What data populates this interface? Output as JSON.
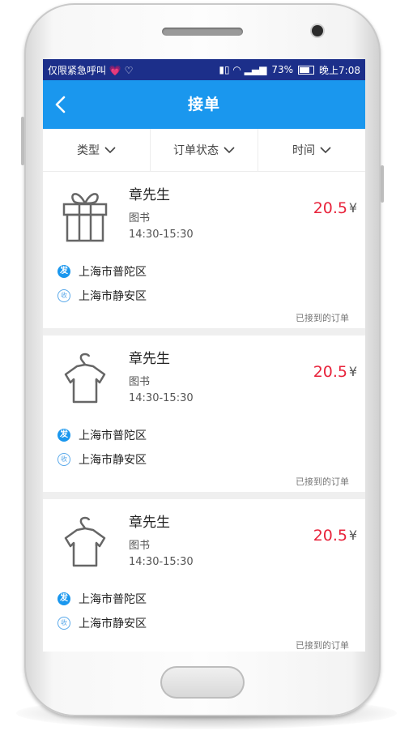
{
  "statusbar": {
    "left": "仅限紧急呼叫 💗 ♡",
    "battery": "73%",
    "time": "晚上7:08"
  },
  "navbar": {
    "title": "接单",
    "back_icon": "chevron-left-icon"
  },
  "filters": [
    {
      "label": "类型"
    },
    {
      "label": "订单状态"
    },
    {
      "label": "时间"
    }
  ],
  "orders": [
    {
      "icon": "gift-icon",
      "name": "章先生",
      "category": "图书",
      "time": "14:30-15:30",
      "price": "20.5",
      "currency": "¥",
      "from_badge": "发",
      "from": "上海市普陀区",
      "to_badge": "收",
      "to": "上海市静安区",
      "status": "已接到的订单"
    },
    {
      "icon": "tshirt-icon",
      "name": "章先生",
      "category": "图书",
      "time": "14:30-15:30",
      "price": "20.5",
      "currency": "¥",
      "from_badge": "发",
      "from": "上海市普陀区",
      "to_badge": "收",
      "to": "上海市静安区",
      "status": "已接到的订单"
    },
    {
      "icon": "tshirt-icon",
      "name": "章先生",
      "category": "图书",
      "time": "14:30-15:30",
      "price": "20.5",
      "currency": "¥",
      "from_badge": "发",
      "from": "上海市普陀区",
      "to_badge": "收",
      "to": "上海市静安区",
      "status": "已接到的订单"
    }
  ],
  "colors": {
    "accent": "#1a97ee",
    "statusbar": "#1c2f8a",
    "price": "#e8233b"
  }
}
